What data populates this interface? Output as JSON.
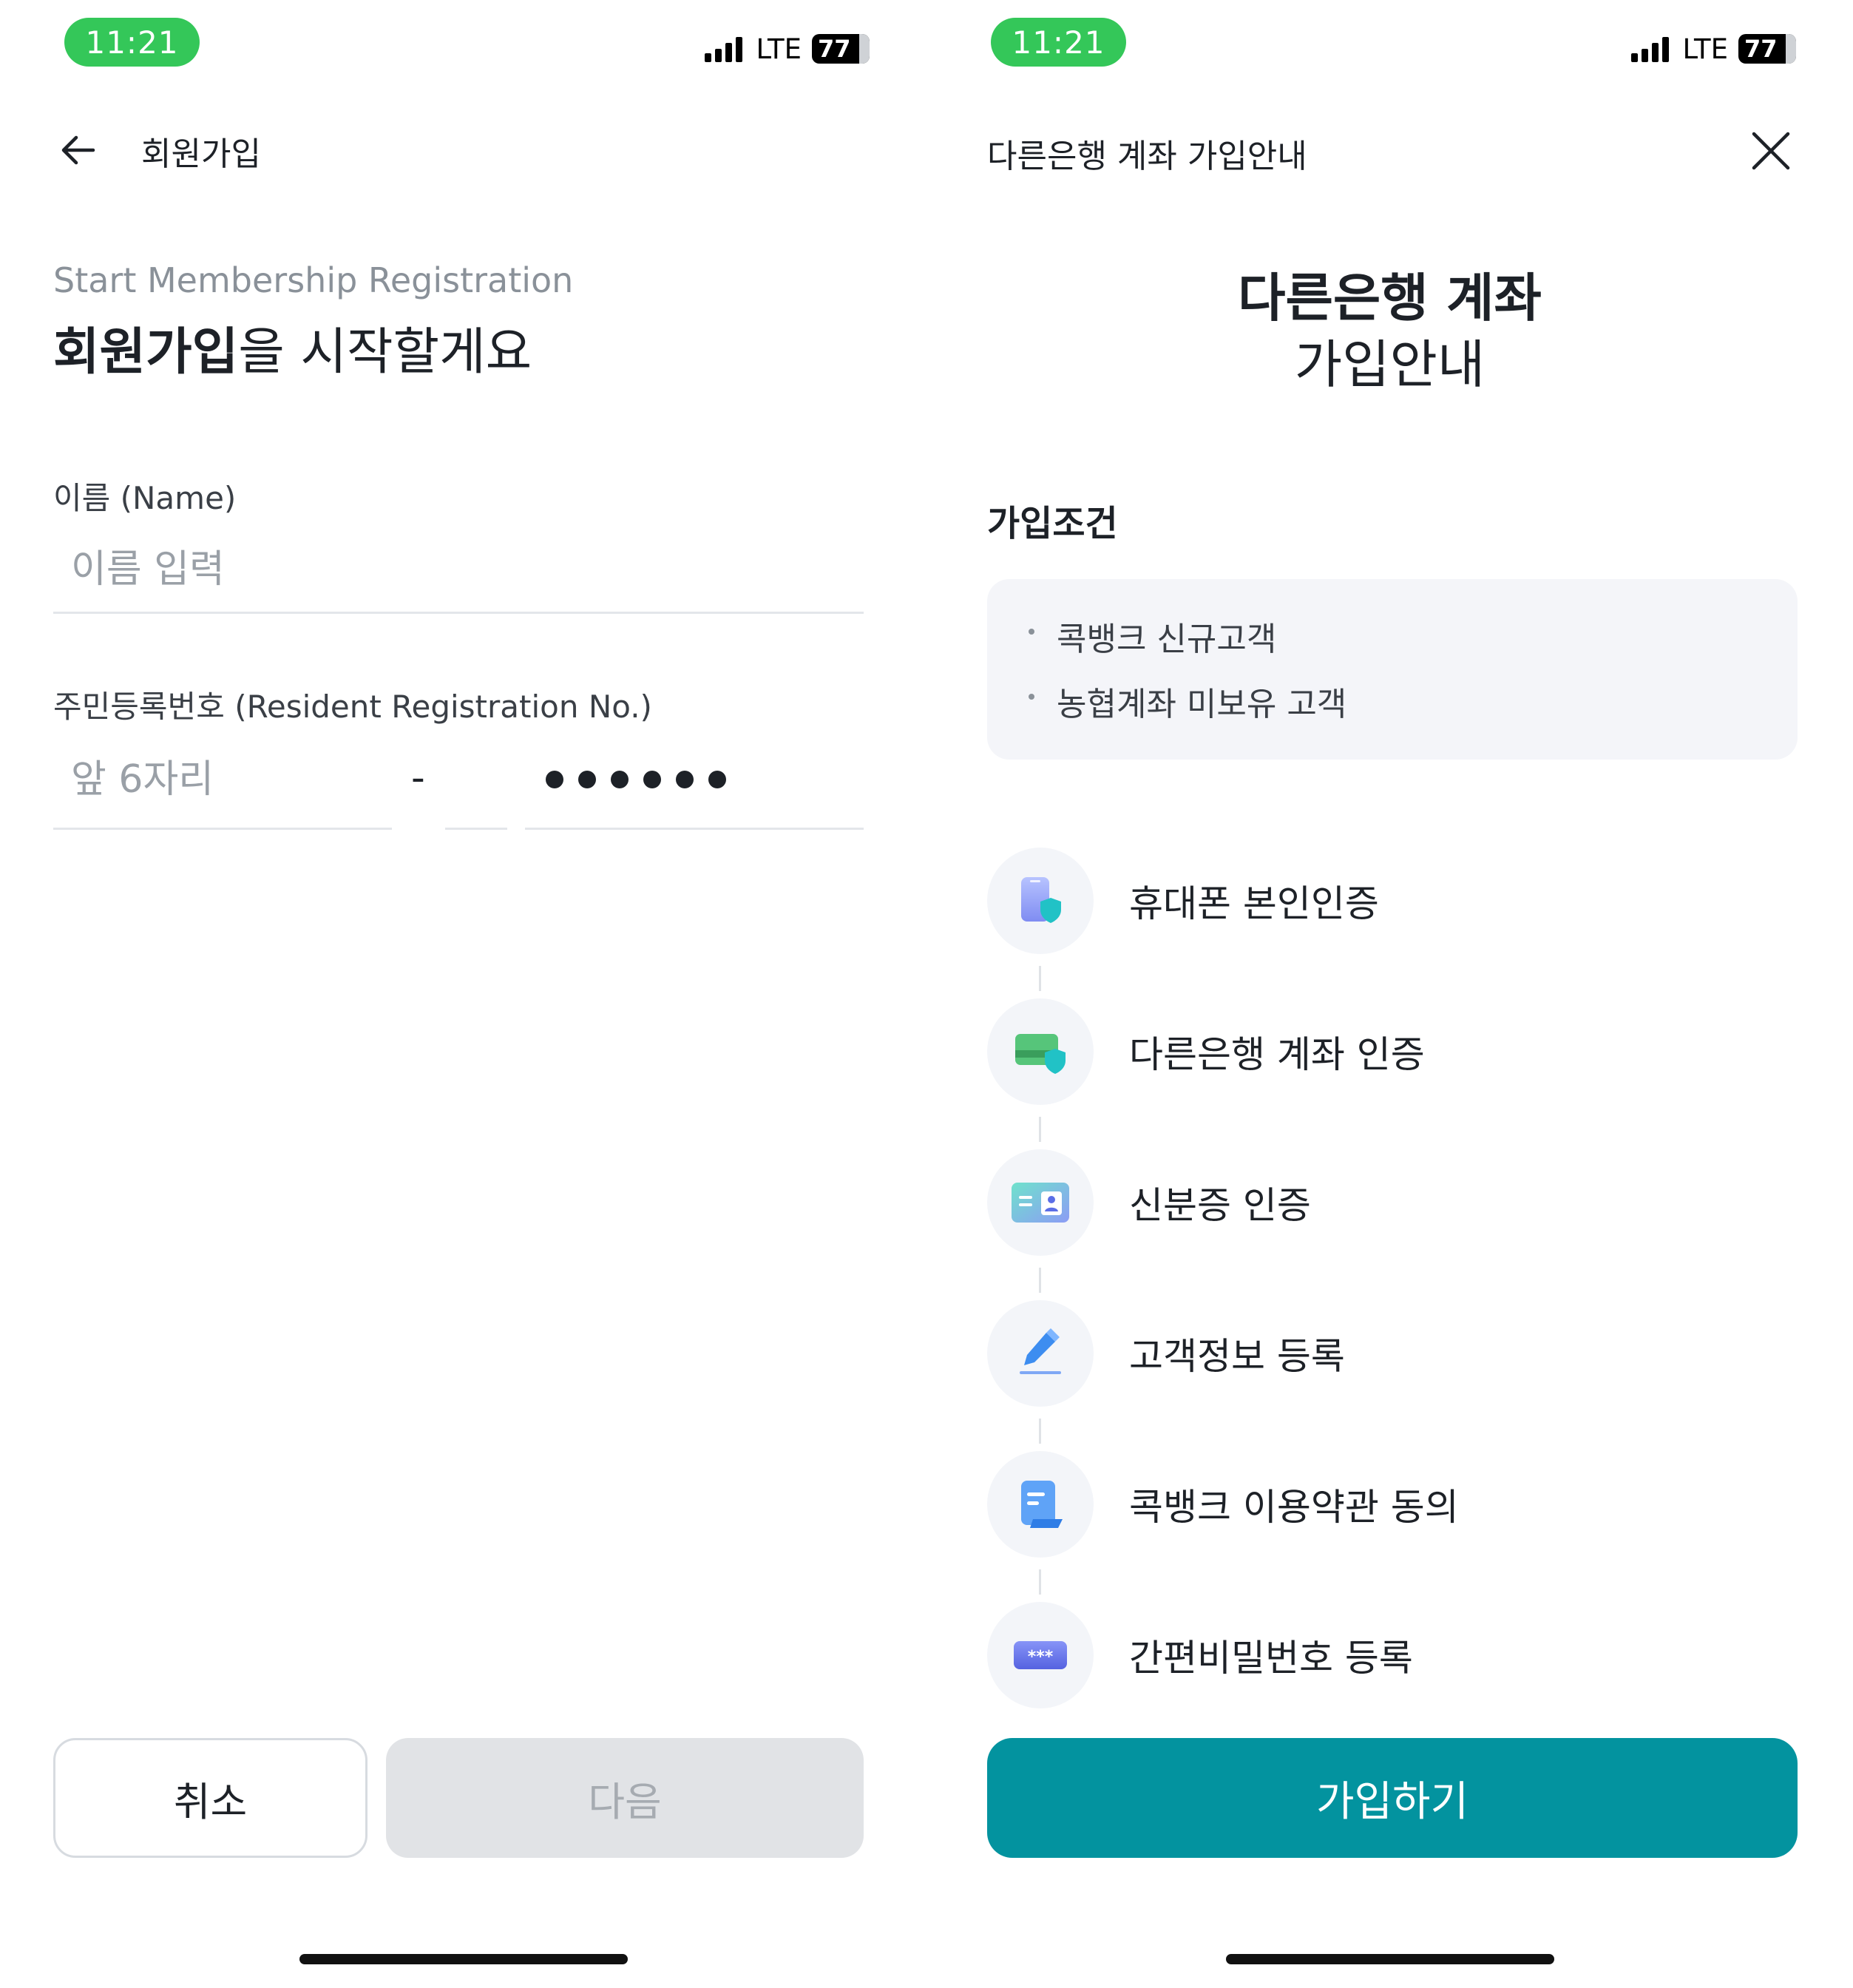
{
  "left": {
    "status": {
      "time": "11:21",
      "network": "LTE",
      "battery": "77"
    },
    "header": {
      "title": "회원가입"
    },
    "subtitle_en": "Start Membership Registration",
    "title_bold": "회원가입",
    "title_rest": "을 시작할게요",
    "name_field": {
      "label": "이름 (Name)",
      "placeholder": "이름 입력"
    },
    "rrn_field": {
      "label": "주민등록번호 (Resident Registration No.)",
      "front_placeholder": "앞 6자리",
      "separator": "-",
      "masked_digits": 6
    },
    "buttons": {
      "cancel": "취소",
      "next": "다음"
    }
  },
  "right": {
    "status": {
      "time": "11:21",
      "network": "LTE",
      "battery": "77"
    },
    "header": {
      "title": "다른은행 계좌 가입안내"
    },
    "title_line1": "다른은행 계좌",
    "title_line2": "가입안내",
    "conditions": {
      "label": "가입조건",
      "items": [
        "콕뱅크 신규고객",
        "농협계좌 미보유 고객"
      ]
    },
    "steps": [
      {
        "label": "휴대폰 본인인증",
        "icon": "phone-shield-icon"
      },
      {
        "label": "다른은행 계좌 인증",
        "icon": "card-shield-icon"
      },
      {
        "label": "신분증 인증",
        "icon": "id-card-icon"
      },
      {
        "label": "고객정보 등록",
        "icon": "pencil-icon"
      },
      {
        "label": "콕뱅크 이용약관 동의",
        "icon": "document-icon"
      },
      {
        "label": "간편비밀번호 등록",
        "icon": "password-icon"
      }
    ],
    "join_button": "가입하기"
  },
  "colors": {
    "status_green": "#34c759",
    "primary_teal": "#03939f",
    "disabled_bg": "#e1e3e6",
    "condition_bg": "#f4f5f9"
  }
}
